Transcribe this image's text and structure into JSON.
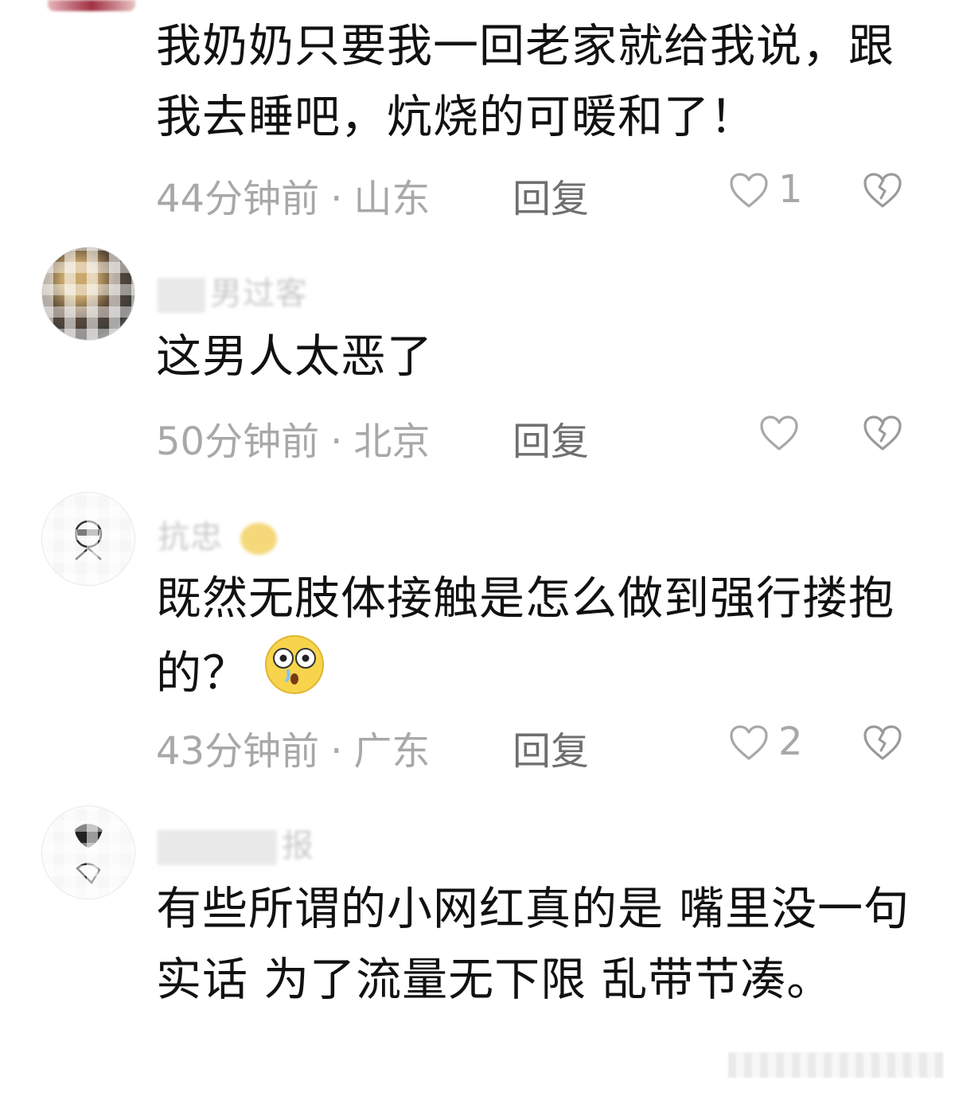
{
  "comments": [
    {
      "text": "我奶奶只要我一回老家就给我说，跟我去睡吧，炕烧的可暖和了！",
      "time": "44分钟前",
      "location": "山东",
      "reply_label": "回复",
      "likes": "1"
    },
    {
      "username": "男过客",
      "text": "这男人太恶了",
      "time": "50分钟前",
      "location": "北京",
      "reply_label": "回复",
      "likes": ""
    },
    {
      "username": "抗忠",
      "text": "既然无肢体接触是怎么做到强行搂抱的？",
      "time": "43分钟前",
      "location": "广东",
      "reply_label": "回复",
      "likes": "2"
    },
    {
      "username": "报",
      "text": "有些所谓的小网红真的是 嘴里没一句实话 为了流量无下限 乱带节凑。",
      "time": "",
      "location": ""
    }
  ],
  "icons": {
    "like": "heart-outline-icon",
    "dislike": "broken-heart-icon",
    "emoji": "shocked-face-emoji"
  },
  "colors": {
    "text": "#111111",
    "meta": "#a8a8a8",
    "reply": "#6f6f6f"
  }
}
